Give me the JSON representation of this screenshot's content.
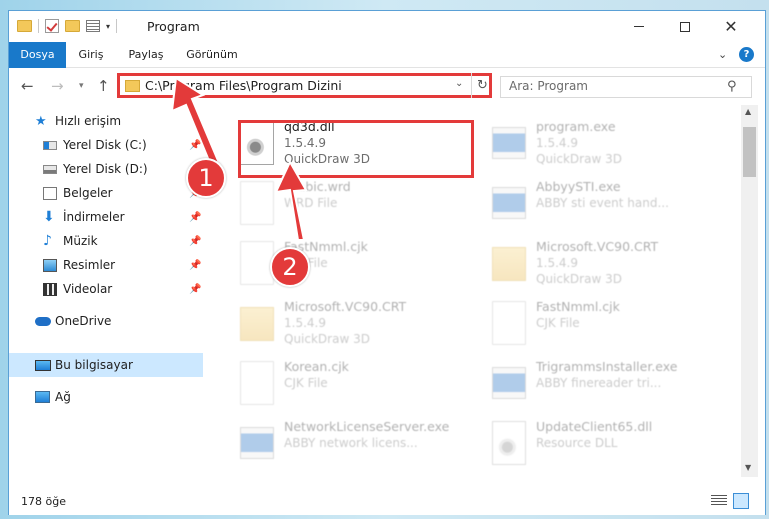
{
  "window": {
    "title": "Program"
  },
  "ribbon": {
    "tabs": [
      "Dosya",
      "Giriş",
      "Paylaş",
      "Görünüm"
    ]
  },
  "address": {
    "path": "C:\\Program Files\\Program Dizini"
  },
  "search": {
    "placeholder": "Ara: Program"
  },
  "sidebar": {
    "quick_access": "Hızlı erişim",
    "items": [
      {
        "label": "Yerel Disk (C:)",
        "pinned": true
      },
      {
        "label": "Yerel Disk (D:)",
        "pinned": true
      },
      {
        "label": "Belgeler",
        "pinned": true
      },
      {
        "label": "İndirmeler",
        "pinned": true
      },
      {
        "label": "Müzik",
        "pinned": true
      },
      {
        "label": "Resimler",
        "pinned": true
      },
      {
        "label": "Videolar",
        "pinned": true
      }
    ],
    "onedrive": "OneDrive",
    "this_pc": "Bu bilgisayar",
    "network": "Ağ"
  },
  "files": [
    {
      "name": "qd3d.dll",
      "line1": "1.5.4.9",
      "line2": "QuickDraw 3D",
      "kind": "dll",
      "highlight": true
    },
    {
      "name": "program.exe",
      "line1": "1.5.4.9",
      "line2": "QuickDraw 3D",
      "kind": "exe"
    },
    {
      "name": "Arabic.wrd",
      "line1": "WRD File",
      "line2": "",
      "kind": "doc"
    },
    {
      "name": "AbbyySTI.exe",
      "line1": "ABBY sti event hand...",
      "line2": "",
      "kind": "exe"
    },
    {
      "name": "FastNmml.cjk",
      "line1": "CJK File",
      "line2": "",
      "kind": "doc"
    },
    {
      "name": "Microsoft.VC90.CRT",
      "line1": "1.5.4.9",
      "line2": "QuickDraw 3D",
      "kind": "folder"
    },
    {
      "name": "Microsoft.VC90.CRT",
      "line1": "1.5.4.9",
      "line2": "QuickDraw 3D",
      "kind": "folder"
    },
    {
      "name": "FastNmml.cjk",
      "line1": "CJK File",
      "line2": "",
      "kind": "doc"
    },
    {
      "name": "Korean.cjk",
      "line1": "CJK File",
      "line2": "",
      "kind": "doc"
    },
    {
      "name": "TrigrammsInstaller.exe",
      "line1": "ABBY finereader tri...",
      "line2": "",
      "kind": "exe"
    },
    {
      "name": "NetworkLicenseServer.exe",
      "line1": "ABBY network licens...",
      "line2": "",
      "kind": "exe"
    },
    {
      "name": "UpdateClient65.dll",
      "line1": "Resource DLL",
      "line2": "",
      "kind": "dll"
    }
  ],
  "status": {
    "count": "178 öğe"
  },
  "callouts": [
    "1",
    "2"
  ],
  "colors": {
    "accent": "#1979ca",
    "highlight": "#e33a3a"
  }
}
